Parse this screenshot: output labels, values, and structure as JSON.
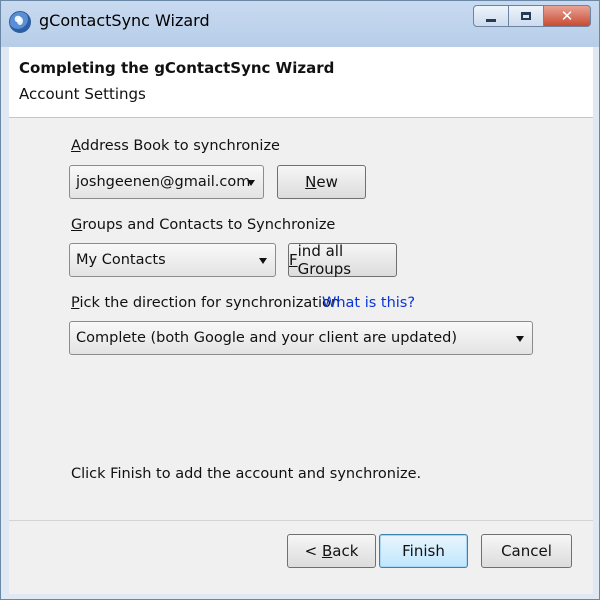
{
  "window": {
    "title": "gContactSync Wizard",
    "controls": {
      "minimize": "minimize",
      "maximize": "maximize",
      "close": "✕"
    }
  },
  "header": {
    "title": "Completing the gContactSync Wizard",
    "subtitle": "Account Settings"
  },
  "form": {
    "address_book": {
      "label_first": "A",
      "label_rest": "ddress Book to synchronize",
      "value": "joshgeenen@gmail.com",
      "new_button_first": "N",
      "new_button_rest": "ew"
    },
    "groups": {
      "label_first": "G",
      "label_rest": "roups and Contacts to Synchronize",
      "value": "My Contacts",
      "find_button_first": "F",
      "find_button_rest": "ind all Groups"
    },
    "direction": {
      "label_first": "P",
      "label_rest": "ick the direction for synchronization",
      "help_link": "What is this?",
      "value": "Complete (both Google and your client are updated)"
    },
    "finish_note": "Click Finish to add the account and synchronize."
  },
  "footer": {
    "back_prefix": "< ",
    "back_first": "B",
    "back_rest": "ack",
    "finish": "Finish",
    "cancel": "Cancel"
  },
  "colors": {
    "link": "#0a34d6",
    "titlebar": "#b7cde8",
    "close_button": "#c94b32"
  }
}
